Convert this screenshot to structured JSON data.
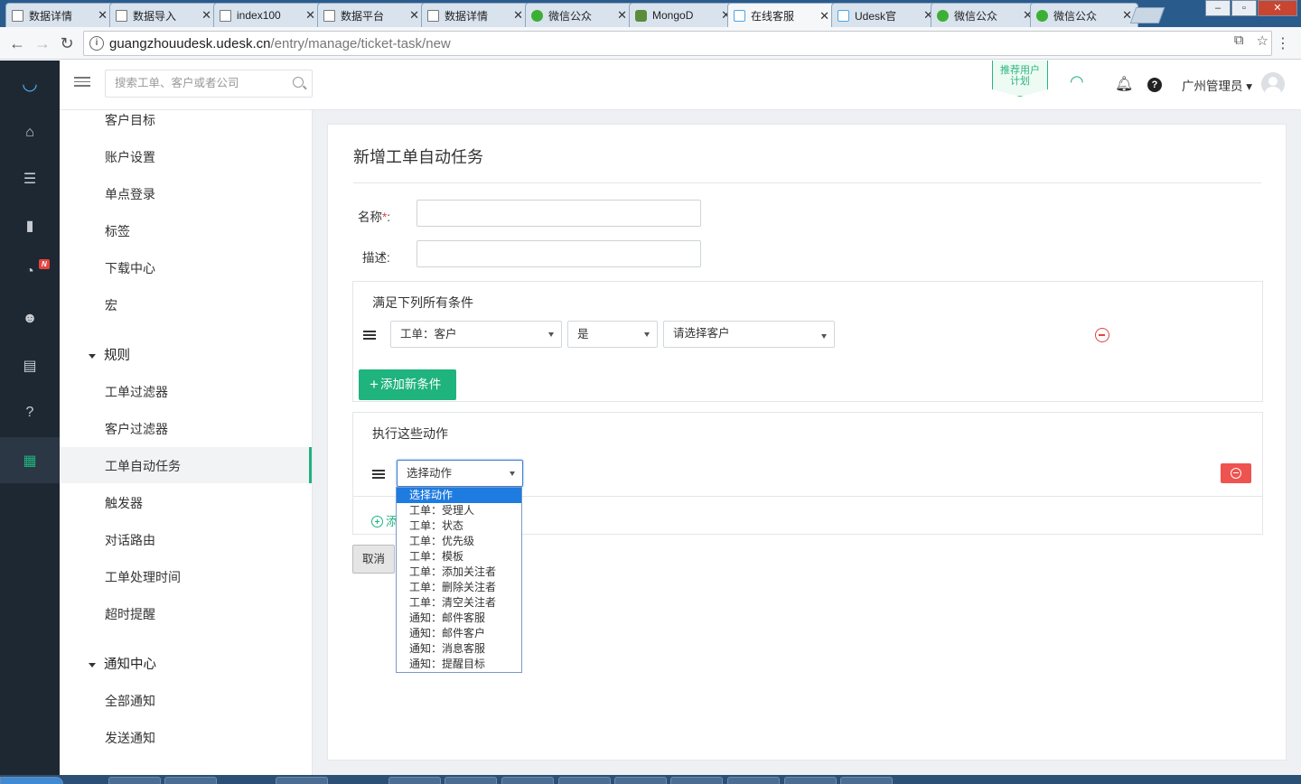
{
  "browser": {
    "tabs": [
      {
        "title": "数据详情",
        "icon": "page-icon"
      },
      {
        "title": "数据导入",
        "icon": "page-icon"
      },
      {
        "title": "index100",
        "icon": "page-icon"
      },
      {
        "title": "数据平台",
        "icon": "page-icon"
      },
      {
        "title": "数据详情",
        "icon": "page-icon"
      },
      {
        "title": "微信公众",
        "icon": "wechat-icon"
      },
      {
        "title": "MongoD",
        "icon": "mongo-icon"
      },
      {
        "title": "在线客服",
        "icon": "udesk-icon"
      },
      {
        "title": "Udesk官",
        "icon": "udesk-icon"
      },
      {
        "title": "微信公众",
        "icon": "wechat-icon"
      },
      {
        "title": "微信公众",
        "icon": "wechat-icon"
      }
    ],
    "active_tab_index": 7,
    "url_host": "guangzhouudesk.udesk.cn",
    "url_path": "/entry/manage/ticket-task/new"
  },
  "header": {
    "search_placeholder": "搜索工单、客户或者公司",
    "recommend_line1": "推荐用户",
    "recommend_line2": "计划",
    "admin_name": "广州管理员"
  },
  "rail": {
    "items": [
      "home-icon",
      "list-icon",
      "bar-chart-icon",
      "pie-chart-icon",
      "users-icon",
      "book-icon",
      "help-icon",
      "apps-icon"
    ],
    "badge": "N",
    "active_index": 7
  },
  "subnav": {
    "items_top": [
      "客户目标",
      "账户设置",
      "单点登录",
      "标签",
      "下载中心",
      "宏"
    ],
    "group_rules": "规则",
    "rules_items": [
      "工单过滤器",
      "客户过滤器",
      "工单自动任务",
      "触发器",
      "对话路由",
      "工单处理时间",
      "超时提醒"
    ],
    "group_notify": "通知中心",
    "notify_items": [
      "全部通知",
      "发送通知"
    ]
  },
  "form": {
    "page_title": "新增工单自动任务",
    "name_label": "名称",
    "name_required_mark": "*",
    "name_suffix": ":",
    "desc_label": "描述:",
    "conditions_title": "满足下列所有条件",
    "condition": {
      "field": "工单：客户",
      "operator": "是",
      "value_placeholder": "请选择客户"
    },
    "add_condition_label": "添加新条件",
    "actions_title": "执行这些动作",
    "action_select_value": "选择动作",
    "add_action_label": "添",
    "cancel_label": "取消"
  },
  "action_dropdown": {
    "options": [
      "选择动作",
      "工单：受理人",
      "工单：状态",
      "工单：优先级",
      "工单：模板",
      "工单：添加关注者",
      "工单：删除关注者",
      "工单：清空关注者",
      "通知：邮件客服",
      "通知：邮件客户",
      "通知：消息客服",
      "通知：提醒目标"
    ],
    "selected_index": 0
  },
  "colors": {
    "accent": "#1fb37e",
    "danger": "#e64340",
    "rail": "#1e2833",
    "selection": "#1e7be0"
  }
}
